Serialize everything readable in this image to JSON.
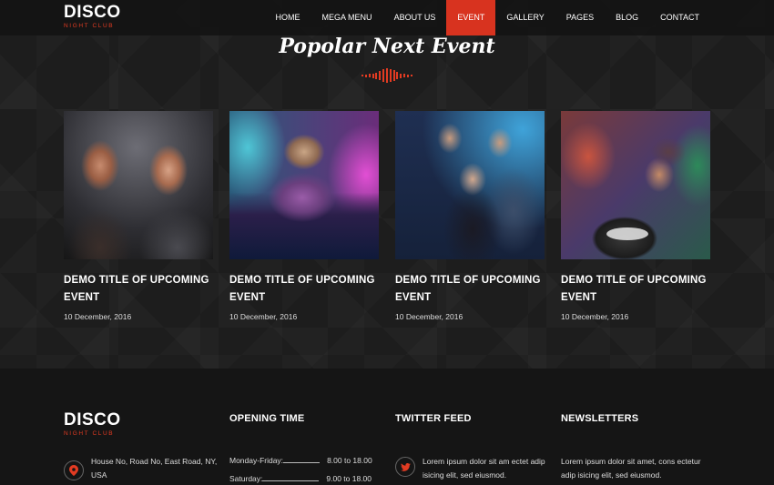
{
  "brand": {
    "name": "DISCO",
    "tagline": "NIGHT CLUB"
  },
  "nav": {
    "items": [
      {
        "label": "HOME",
        "active": false
      },
      {
        "label": "MEGA MENU",
        "active": false
      },
      {
        "label": "ABOUT US",
        "active": false
      },
      {
        "label": "EVENT",
        "active": true
      },
      {
        "label": "GALLERY",
        "active": false
      },
      {
        "label": "PAGES",
        "active": false
      },
      {
        "label": "BLOG",
        "active": false
      },
      {
        "label": "CONTACT",
        "active": false
      }
    ]
  },
  "section": {
    "title": "Popolar Next Event"
  },
  "events": [
    {
      "title": "DEMO TITLE OF UPCOMING EVENT",
      "date": "10 December, 2016"
    },
    {
      "title": "DEMO TITLE OF UPCOMING EVENT",
      "date": "10 December, 2016"
    },
    {
      "title": "DEMO TITLE OF UPCOMING EVENT",
      "date": "10 December, 2016"
    },
    {
      "title": "DEMO TITLE OF UPCOMING EVENT",
      "date": "10 December, 2016"
    }
  ],
  "footer": {
    "address": "House No, Road No, East Road, NY, USA",
    "opening": {
      "title": "OPENING TIME",
      "rows": [
        {
          "day": "Monday-Friday:",
          "time": "8.00 to 18.00"
        },
        {
          "day": "Saturday:",
          "time": "9.00 to 18.00"
        }
      ]
    },
    "twitter": {
      "title": "TWITTER FEED",
      "text": "Lorem ipsum dolor sit am ectet adip isicing elit, sed eiusmod."
    },
    "newsletter": {
      "title": "NEWSLETTERS",
      "text": "Lorem ipsum dolor sit amet, cons ectetur adip isicing elit, sed eiusmod."
    }
  },
  "colors": {
    "accent": "#d8331f",
    "background": "#1b1b1b"
  },
  "icons": [
    "map-pin-icon",
    "twitter-icon",
    "equalizer-icon"
  ]
}
